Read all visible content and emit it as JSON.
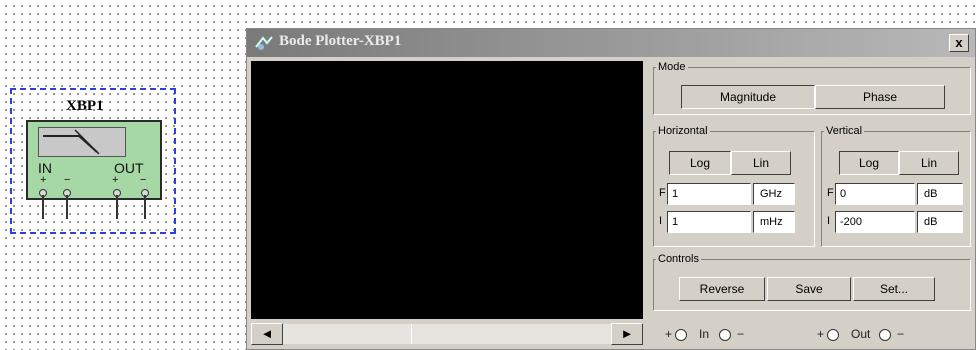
{
  "component": {
    "name": "XBP1",
    "in_label": "IN",
    "out_label": "OUT",
    "plus": "+",
    "minus": "−"
  },
  "window": {
    "title": "Bode Plotter-XBP1",
    "close": "x"
  },
  "scrollbar": {
    "left": "◄",
    "right": "►"
  },
  "mode": {
    "legend": "Mode",
    "magnitude": "Magnitude",
    "phase": "Phase"
  },
  "horizontal": {
    "legend": "Horizontal",
    "log": "Log",
    "lin": "Lin",
    "f_label": "F",
    "f_value": "1",
    "f_unit": "GHz",
    "i_label": "I",
    "i_value": "1",
    "i_unit": "mHz"
  },
  "vertical": {
    "legend": "Vertical",
    "log": "Log",
    "lin": "Lin",
    "f_label": "F",
    "f_value": "0",
    "f_unit": "dB",
    "i_label": "I",
    "i_value": "-200",
    "i_unit": "dB"
  },
  "controls": {
    "legend": "Controls",
    "reverse": "Reverse",
    "save": "Save",
    "set": "Set..."
  },
  "terminals": {
    "plus1": "+",
    "in": "In",
    "minus1": "−",
    "plus2": "+",
    "out": "Out",
    "minus2": "−"
  }
}
